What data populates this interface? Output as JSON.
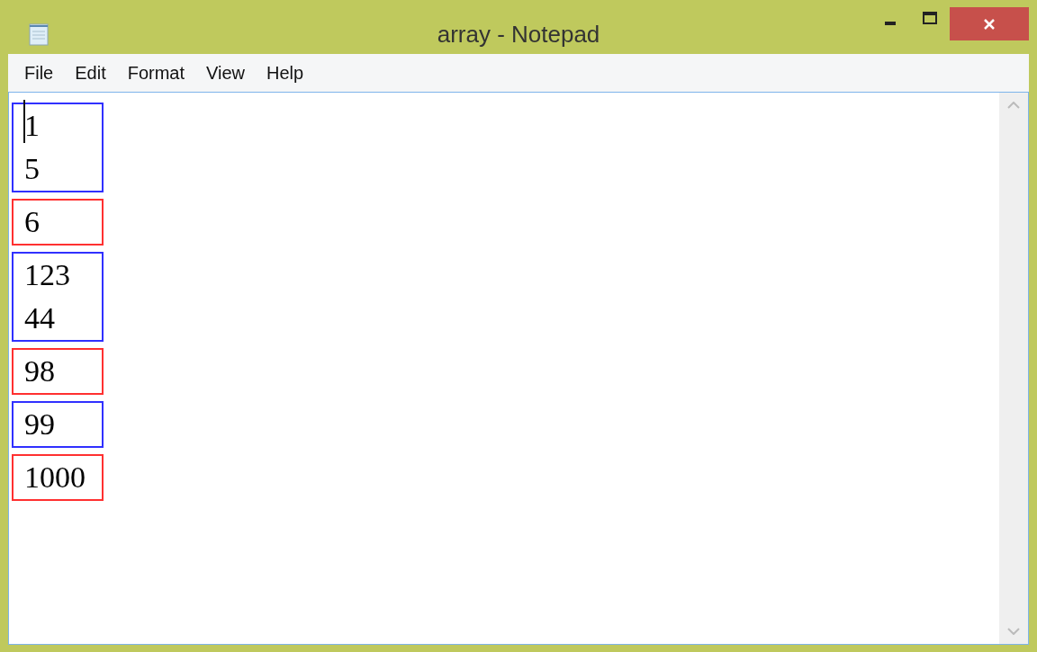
{
  "window": {
    "title": "array - Notepad"
  },
  "menu": [
    "File",
    "Edit",
    "Format",
    "View",
    "Help"
  ],
  "editor": {
    "groups": [
      {
        "color": "#3030ff",
        "lines": [
          "1",
          "5"
        ]
      },
      {
        "color": "#ff3030",
        "lines": [
          "6"
        ]
      },
      {
        "color": "#3030ff",
        "lines": [
          "123",
          "44"
        ]
      },
      {
        "color": "#ff3030",
        "lines": [
          "98"
        ]
      },
      {
        "color": "#3030ff",
        "lines": [
          "99"
        ]
      },
      {
        "color": "#ff3030",
        "lines": [
          "1000"
        ]
      }
    ]
  }
}
